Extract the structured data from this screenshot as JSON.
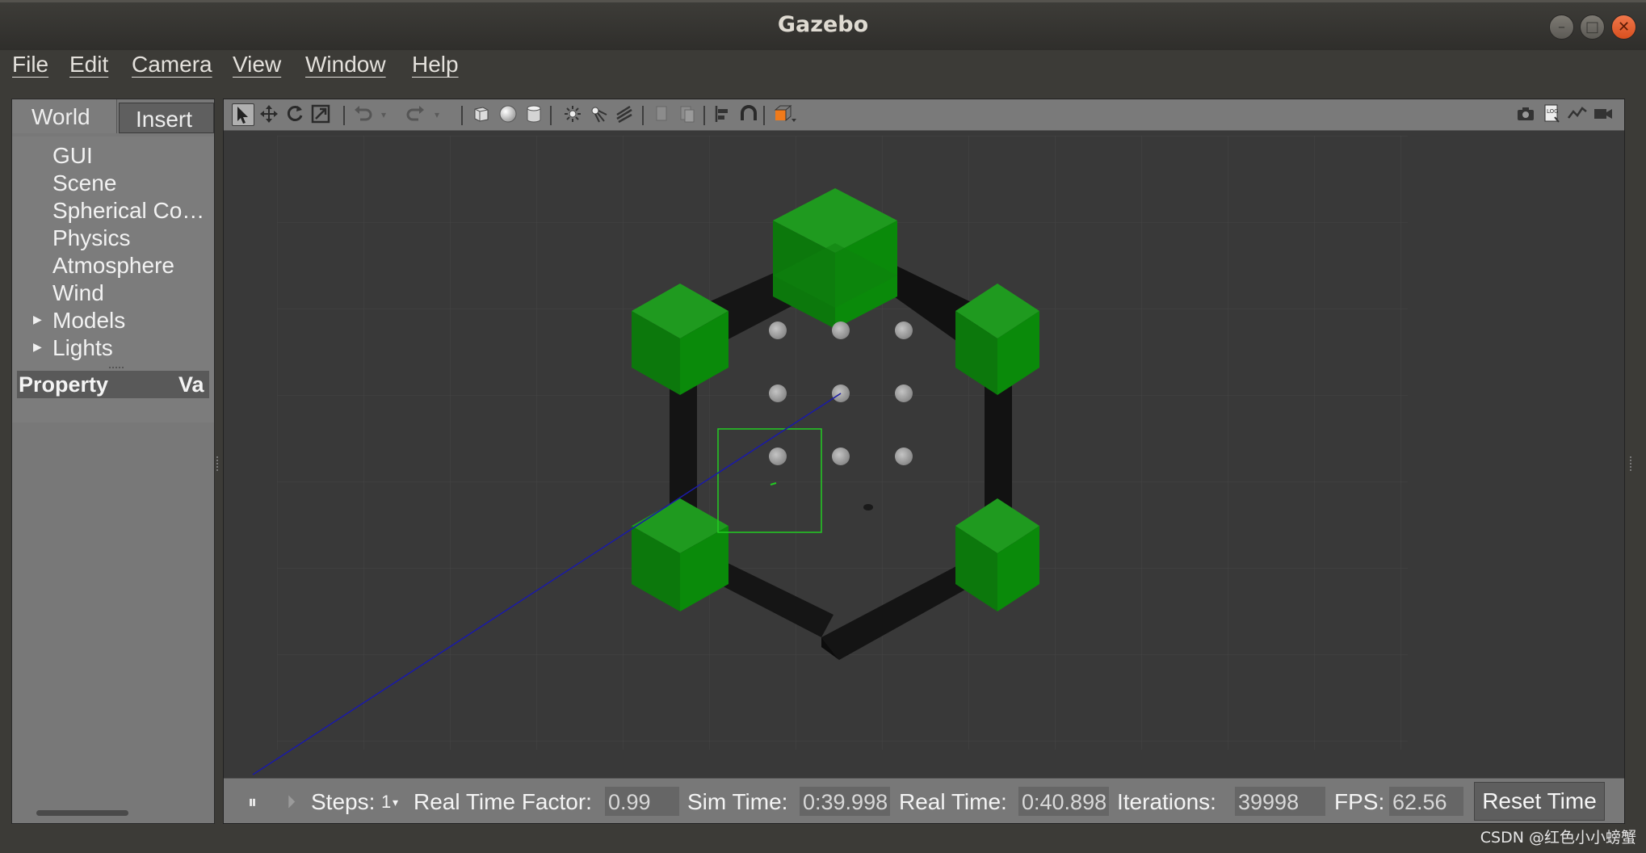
{
  "window": {
    "title": "Gazebo",
    "minimize": "–",
    "maximize": "□",
    "close": "✕"
  },
  "menu": [
    "File",
    "Edit",
    "Camera",
    "View",
    "Window",
    "Help"
  ],
  "left_panel": {
    "tabs": [
      "World",
      "Insert"
    ],
    "tree": [
      "GUI",
      "Scene",
      "Spherical Co…",
      "Physics",
      "Atmosphere",
      "Wind",
      "Models",
      "Lights"
    ],
    "property_header": {
      "col1": "Property",
      "col2": "Va"
    }
  },
  "toolbar": {
    "icons": [
      "select-icon",
      "translate-icon",
      "rotate-icon",
      "scale-icon",
      "undo-icon",
      "redo-icon",
      "box-icon",
      "sphere-icon",
      "cylinder-icon",
      "point-light-icon",
      "spot-light-icon",
      "directional-light-icon",
      "copy-icon",
      "paste-icon",
      "align-icon",
      "snap-icon",
      "view-angle-icon"
    ],
    "right_icons": [
      "screenshot-icon",
      "log-icon",
      "plot-icon",
      "record-video-icon"
    ]
  },
  "status": {
    "pause_icon": "⏸",
    "step_icon": "⏵",
    "steps_label": "Steps:",
    "steps_value": "1",
    "rtf_label": "Real Time Factor:",
    "rtf_value": "0.99",
    "sim_time_label": "Sim Time:",
    "sim_time_value": "0:39.998",
    "real_time_label": "Real Time:",
    "real_time_value": "0:40.898",
    "iterations_label": "Iterations:",
    "iterations_value": "39998",
    "fps_label": "FPS:",
    "fps_value": "62.56",
    "reset_label": "Reset Time"
  },
  "colors": {
    "cube_green": "#0a8a0a",
    "selection_box": "#22cc22",
    "ray_line": "#1a1aa8"
  },
  "watermark": "CSDN @红色小小螃蟹"
}
